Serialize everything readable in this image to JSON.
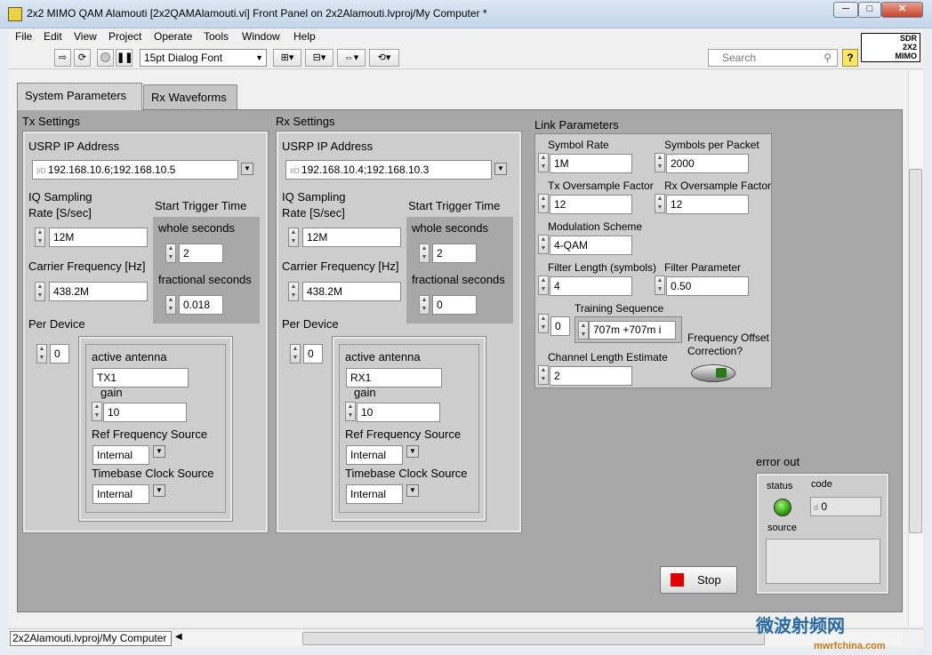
{
  "window": {
    "title": "2x2 MIMO QAM Alamouti [2x2QAMAlamouti.vi] Front Panel on 2x2Alamouti.lvproj/My Computer *",
    "minimize": "─",
    "maximize": "□",
    "close": "✕"
  },
  "menu": [
    "File",
    "Edit",
    "View",
    "Project",
    "Operate",
    "Tools",
    "Window",
    "Help"
  ],
  "toolbar": {
    "font": "15pt Dialog Font",
    "search_placeholder": "Search",
    "help": "?"
  },
  "logo": {
    "line1": "SDR",
    "line2": "2X2",
    "line3": "MIMO"
  },
  "tabs": [
    "System Parameters",
    "Rx Waveforms"
  ],
  "tx": {
    "title": "Tx Settings",
    "usrp_label": "USRP IP Address",
    "usrp_value": "192.168.10.6;192.168.10.5",
    "iq_label_1": "IQ Sampling",
    "iq_label_2": "Rate [S/sec]",
    "iq_value": "12M",
    "trigger_label": "Start Trigger Time",
    "whole_label": "whole seconds",
    "whole_value": "2",
    "frac_label": "fractional seconds",
    "frac_value": "0.018",
    "carrier_label": "Carrier Frequency [Hz]",
    "carrier_value": "438.2M",
    "per_device_label": "Per Device",
    "index_value": "0",
    "antenna_label": "active antenna",
    "antenna_value": "TX1",
    "gain_label": "gain",
    "gain_value": "10",
    "ref_label": "Ref Frequency Source",
    "ref_value": "Internal",
    "timebase_label": "Timebase Clock Source",
    "timebase_value": "Internal"
  },
  "rx": {
    "title": "Rx Settings",
    "usrp_label": "USRP IP Address",
    "usrp_value": "192.168.10.4;192.168.10.3",
    "iq_label_1": "IQ Sampling",
    "iq_label_2": "Rate [S/sec]",
    "iq_value": "12M",
    "trigger_label": "Start Trigger Time",
    "whole_label": "whole seconds",
    "whole_value": "2",
    "frac_label": "fractional seconds",
    "frac_value": "0",
    "carrier_label": "Carrier Frequency [Hz]",
    "carrier_value": "438.2M",
    "per_device_label": "Per Device",
    "index_value": "0",
    "antenna_label": "active antenna",
    "antenna_value": "RX1",
    "gain_label": "gain",
    "gain_value": "10",
    "ref_label": "Ref Frequency Source",
    "ref_value": "Internal",
    "timebase_label": "Timebase Clock Source",
    "timebase_value": "Internal"
  },
  "link": {
    "title": "Link Parameters",
    "symbol_rate_label": "Symbol Rate",
    "symbol_rate_value": "1M",
    "symbols_per_packet_label": "Symbols per Packet",
    "symbols_per_packet_value": "2000",
    "tx_os_label": "Tx Oversample Factor",
    "tx_os_value": "12",
    "rx_os_label": "Rx Oversample Factor",
    "rx_os_value": "12",
    "modulation_label": "Modulation Scheme",
    "modulation_value": "4-QAM",
    "filter_len_label": "Filter Length (symbols)",
    "filter_len_value": "4",
    "filter_param_label": "Filter Parameter",
    "filter_param_value": "0.50",
    "training_label": "Training Sequence",
    "training_index": "0",
    "training_value": "707m +707m i",
    "foc_label_1": "Frequency Offset",
    "foc_label_2": "Correction?",
    "chan_len_label": "Channel Length Estimate",
    "chan_len_value": "2"
  },
  "error": {
    "title": "error out",
    "status_label": "status",
    "code_label": "code",
    "code_prefix": "d",
    "code_value": "0",
    "source_label": "source",
    "source_value": ""
  },
  "stop_label": "Stop",
  "status_path": "2x2Alamouti.lvproj/My Computer",
  "watermark": "微波射频网",
  "watermark_sub": "mwrfchina.com"
}
